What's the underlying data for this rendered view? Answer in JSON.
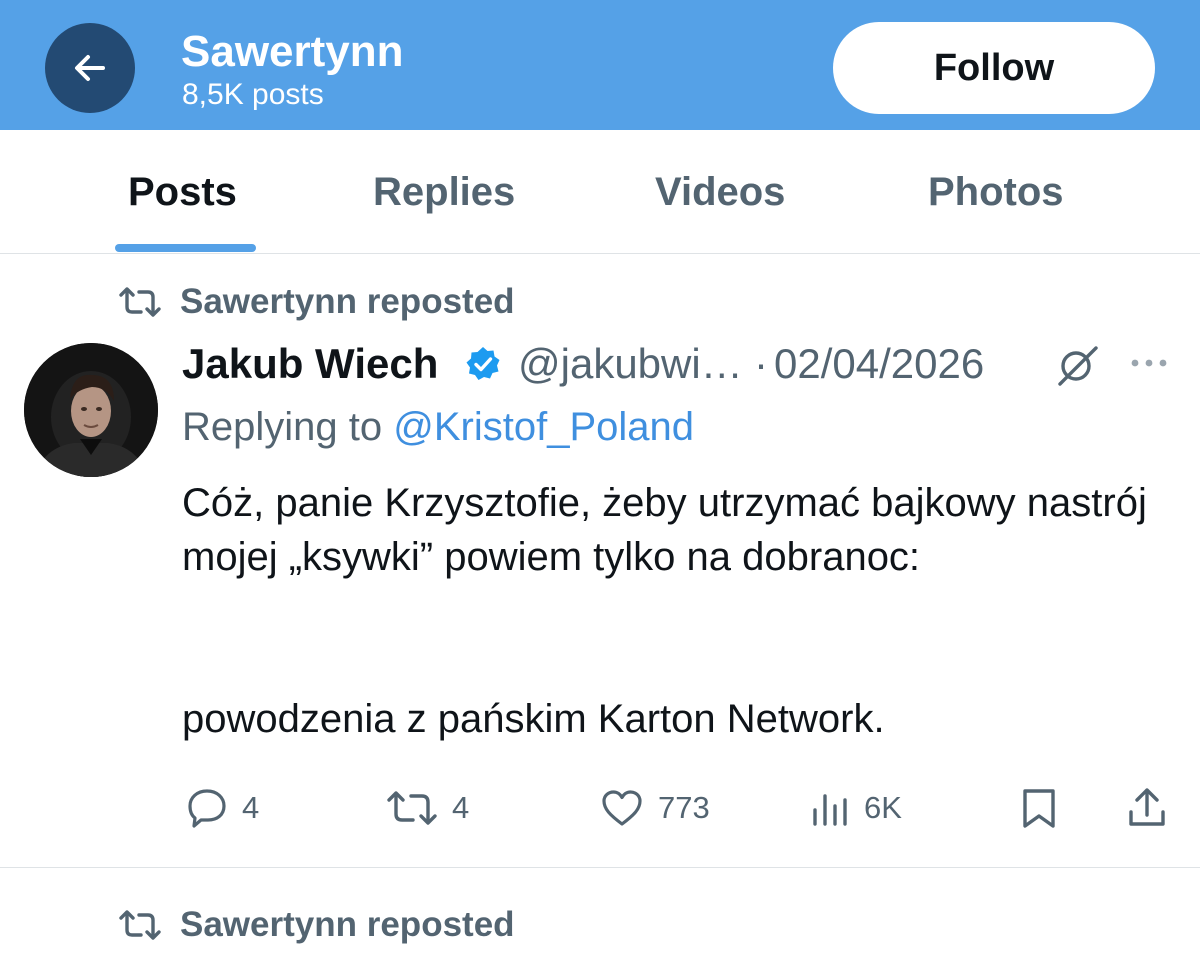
{
  "header": {
    "profile_name": "Sawertynn",
    "post_count": "8,5K posts",
    "follow_label": "Follow",
    "back_icon": "arrow-left-icon",
    "bg_color": "#55a1e7"
  },
  "tabs": [
    {
      "label": "Posts",
      "active": true
    },
    {
      "label": "Replies",
      "active": false
    },
    {
      "label": "Videos",
      "active": false
    },
    {
      "label": "Photos",
      "active": false
    }
  ],
  "posts": [
    {
      "repost_label": "Sawertynn reposted",
      "author_name": "Jakub Wiech",
      "verified": true,
      "handle": "@jakubwi…",
      "separator": "·",
      "date": "02/04/2026",
      "replying_prefix": "Replying to",
      "replying_handle": "@Kristof_Poland",
      "text_paragraph_1": "Cóż, panie Krzysztofie, żeby utrzymać bajkowy nastrój mojej „ksywki” powiem tylko na dobranoc:",
      "text_paragraph_2": "powodzenia z pańskim Karton Network.",
      "replies": "4",
      "reposts": "4",
      "likes": "773",
      "views": "6K"
    },
    {
      "repost_label": "Sawertynn reposted"
    }
  ],
  "colors": {
    "accent": "#55a1e7",
    "link": "#3f8fdf",
    "secondary_text": "#536471",
    "primary_text": "#0f1419",
    "verified_badge": "#1d9bf0"
  }
}
